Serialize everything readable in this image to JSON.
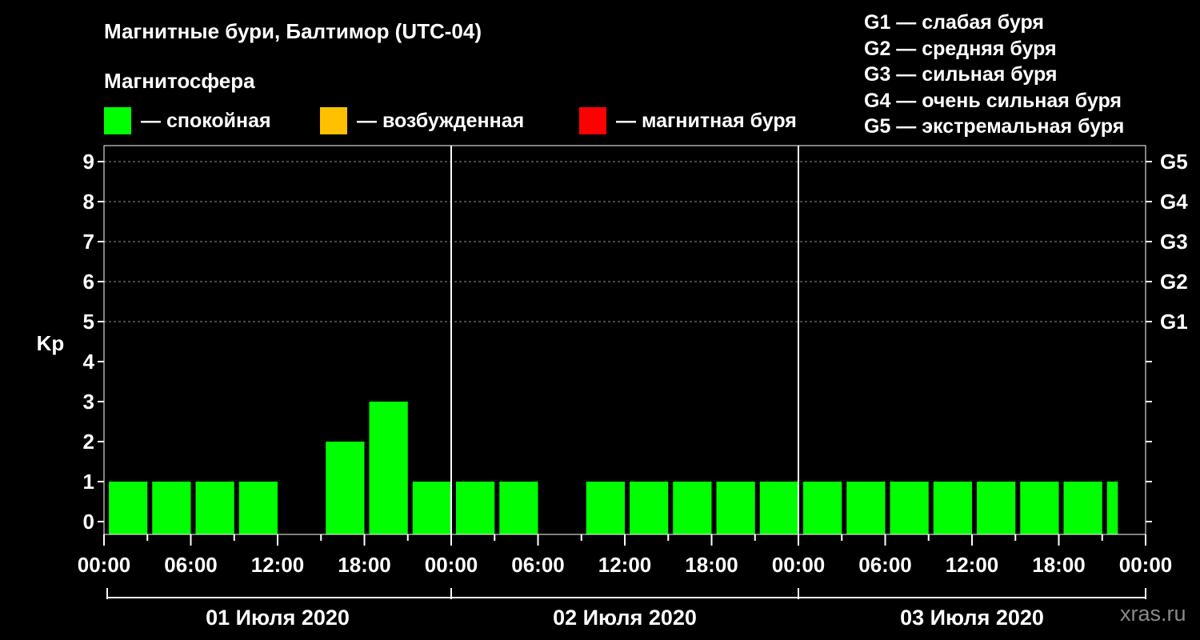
{
  "chart_data": {
    "type": "bar",
    "title": "Магнитные бури, Балтимор (UTC-04)",
    "ylabel": "Kp",
    "ylim": [
      0,
      9
    ],
    "yticks": [
      0,
      1,
      2,
      3,
      4,
      5,
      6,
      7,
      8,
      9
    ],
    "right_axis_labels": [
      {
        "kp": 5,
        "label": "G1"
      },
      {
        "kp": 6,
        "label": "G2"
      },
      {
        "kp": 7,
        "label": "G3"
      },
      {
        "kp": 8,
        "label": "G4"
      },
      {
        "kp": 9,
        "label": "G5"
      }
    ],
    "x_tick_labels": [
      "00:00",
      "06:00",
      "12:00",
      "18:00",
      "00:00",
      "06:00",
      "12:00",
      "18:00",
      "00:00",
      "06:00",
      "12:00",
      "18:00",
      "00:00"
    ],
    "days": [
      "01 Июля 2020",
      "02 Июля 2020",
      "03 Июля 2020"
    ],
    "interval_hours": 3,
    "values": [
      1,
      1,
      1,
      1,
      0,
      2,
      3,
      1,
      1,
      1,
      0,
      1,
      1,
      1,
      1,
      1,
      1,
      1,
      1,
      1,
      1,
      1,
      1,
      1
    ],
    "last_bar_partial": true,
    "colors": {
      "quiet": "#00ff00",
      "excited": "#ffc000",
      "storm": "#ff0000",
      "grid": "#8c8c8c"
    }
  },
  "legend": {
    "title": "Магнитосфера",
    "items": [
      {
        "label": "— спокойная",
        "color": "#00ff00"
      },
      {
        "label": "— возбужденная",
        "color": "#ffc000"
      },
      {
        "label": "— магнитная буря",
        "color": "#ff0000"
      }
    ]
  },
  "g_scale": [
    "G1 — слабая буря",
    "G2 — средняя буря",
    "G3 — сильная буря",
    "G4 — очень сильная буря",
    "G5 — экстремальная буря"
  ],
  "watermark": "xras.ru"
}
